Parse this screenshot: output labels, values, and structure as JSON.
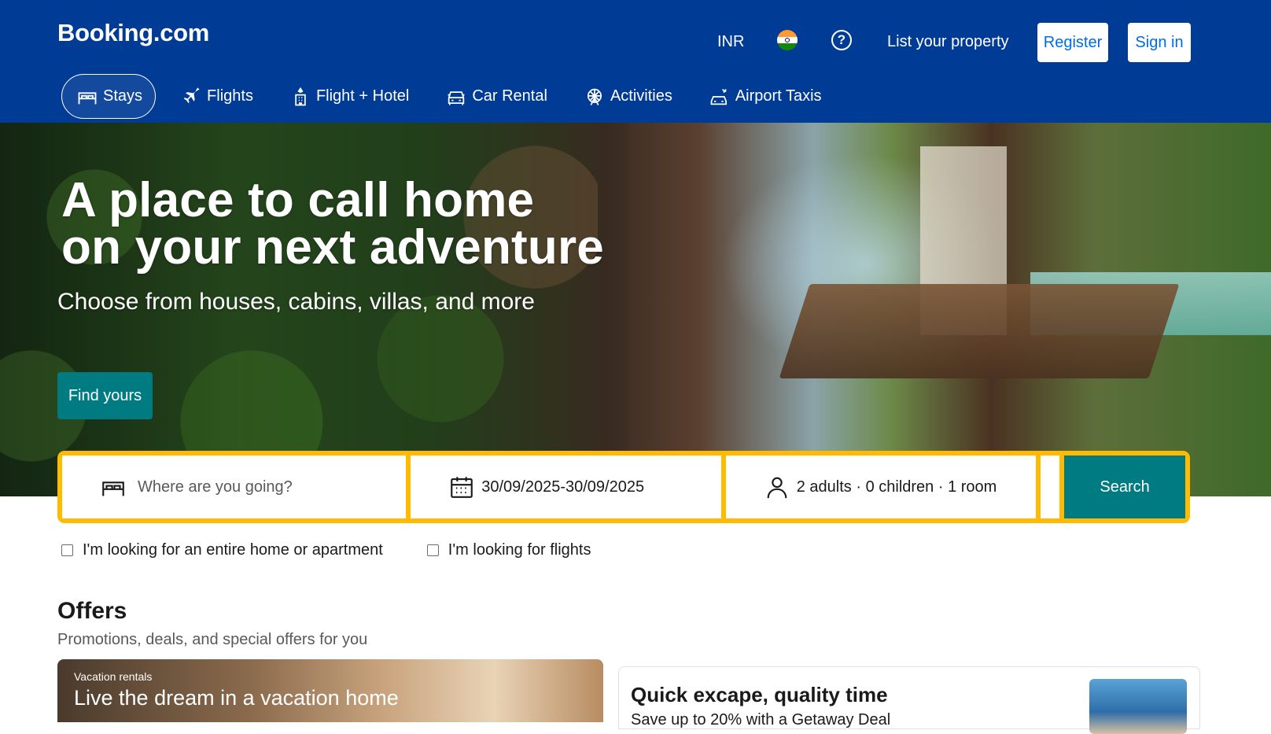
{
  "header": {
    "logo": "Booking.com",
    "currency": "INR",
    "help_symbol": "?",
    "list_property": "List your property",
    "register": "Register",
    "sign_in": "Sign in",
    "colors": {
      "bg": "#003b95",
      "button_text": "#006ce4"
    }
  },
  "nav": {
    "items": [
      {
        "label": "Stays",
        "icon": "bed-icon",
        "active": true
      },
      {
        "label": "Flights",
        "icon": "plane-icon"
      },
      {
        "label": "Flight + Hotel",
        "icon": "flight-hotel-icon"
      },
      {
        "label": "Car Rental",
        "icon": "car-icon"
      },
      {
        "label": "Activities",
        "icon": "ferris-wheel-icon"
      },
      {
        "label": "Airport Taxis",
        "icon": "taxi-icon"
      }
    ]
  },
  "hero": {
    "title_line1": "A place to call home",
    "title_line2": "on your next adventure",
    "subtitle": "Choose from houses, cabins, villas, and more",
    "cta": "Find yours",
    "cta_color": "#007b82"
  },
  "search": {
    "destination_placeholder": "Where are you going?",
    "dates": "30/09/2025-30/09/2025",
    "guests": "2 adults · 0 children · 1 room",
    "button": "Search",
    "border_color": "#febb02"
  },
  "checkboxes": [
    {
      "label": "I'm looking for an entire home or apartment",
      "checked": false
    },
    {
      "label": "I'm looking for flights",
      "checked": false
    }
  ],
  "offers": {
    "title": "Offers",
    "subtitle": "Promotions, deals, and special offers for you",
    "card1": {
      "tag": "Vacation rentals",
      "title": "Live the dream in a vacation home"
    },
    "card2": {
      "title": "Quick excape, quality time",
      "subtitle": "Save up to 20% with a Getaway Deal"
    }
  }
}
